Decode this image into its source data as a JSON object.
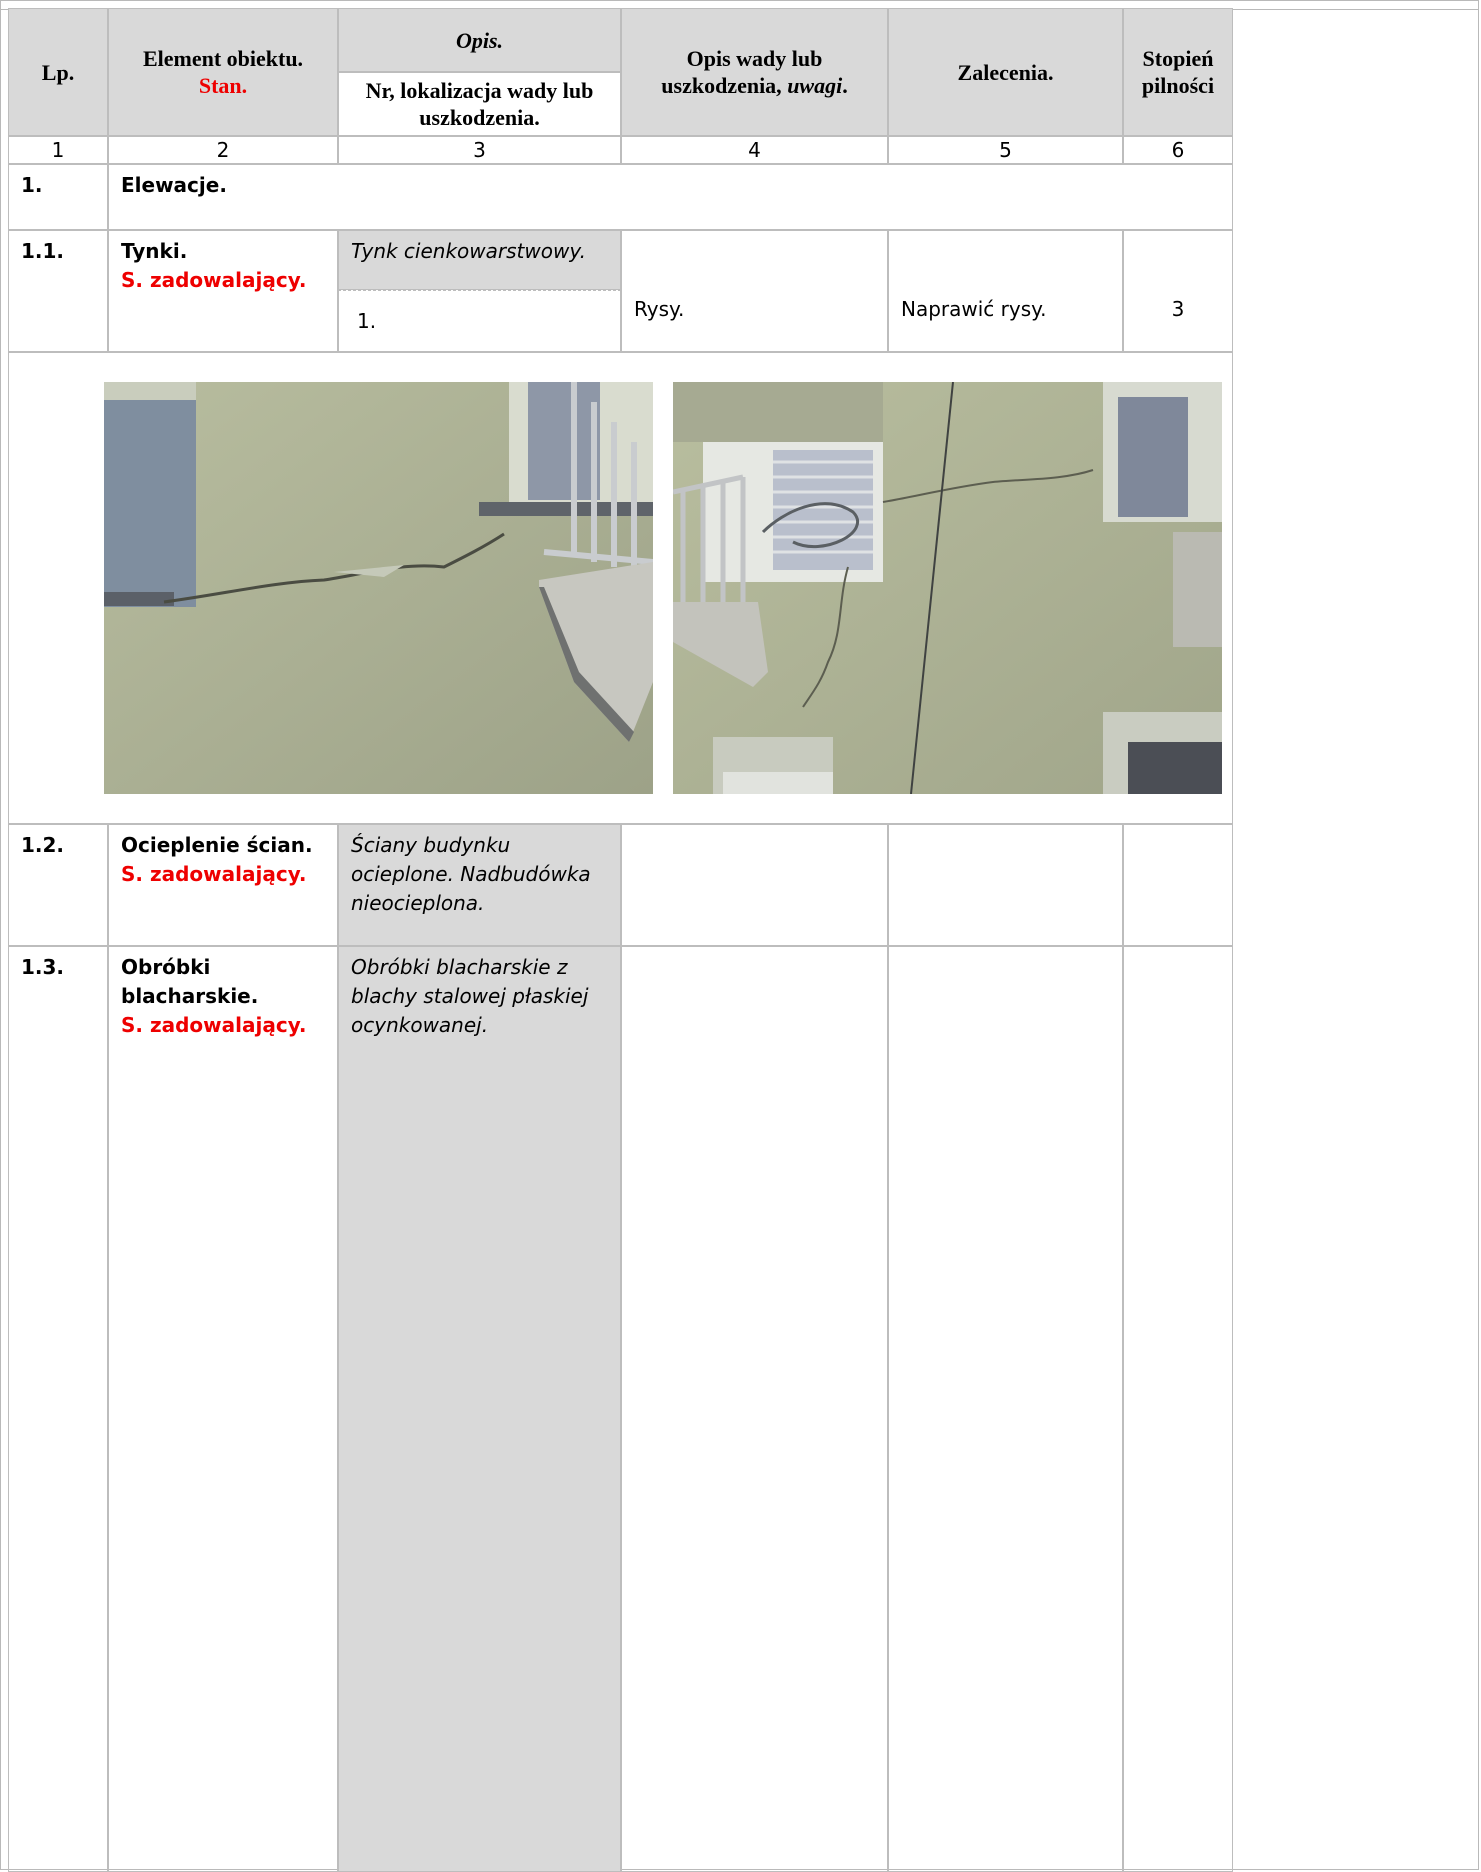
{
  "header": {
    "lp": "Lp.",
    "element": "Element obiektu.",
    "stan": "Stan.",
    "opis": "Opis.",
    "nr_lokalizacja": "Nr, lokalizacja wady lub uszkodzenia.",
    "opis_wady_a": "Opis wady lub",
    "opis_wady_b": "uszkodzenia,",
    "uwagi": "uwagi",
    "opis_wady_dot": ".",
    "zalecenia": "Zalecenia.",
    "stopien_a": "Stopień",
    "stopien_b": "pilności"
  },
  "column_numbers": [
    "1",
    "2",
    "3",
    "4",
    "5",
    "6"
  ],
  "sections": [
    {
      "lp": "1.",
      "title": "Elewacje."
    }
  ],
  "rows": [
    {
      "lp": "1.1.",
      "element": "Tynki.",
      "stan": "S. zadowalający.",
      "opis": "Tynk cienkowarstwowy.",
      "nr": "1.",
      "wada": "Rysy.",
      "zalecenia": "Naprawić rysy.",
      "stopien": "3"
    },
    {
      "lp": "1.2.",
      "element": "Ocieplenie ścian.",
      "stan": "S. zadowalający.",
      "opis": "Ściany budynku ocieplone. Nadbudówka nieocieplona."
    },
    {
      "lp": "1.3.",
      "element": "Obróbki blacharskie.",
      "stan": "S. zadowalający.",
      "opis": "Obróbki blacharskie z blachy stalowej płaskiej ocynkowanej."
    }
  ],
  "photos": [
    {
      "subject": "elevation-crack-photo-1"
    },
    {
      "subject": "elevation-crack-photo-2"
    }
  ],
  "colors": {
    "status_red": "#ee0000",
    "header_gray": "#d9d9d9",
    "border": "#bdbdbd"
  }
}
